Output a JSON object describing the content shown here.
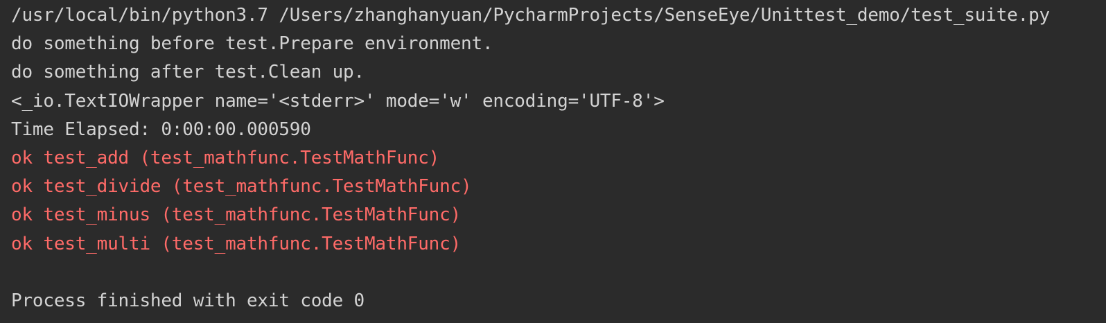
{
  "colors": {
    "background": "#2b2b2b",
    "stdout": "#d3d3d3",
    "stderr": "#ff6b68"
  },
  "console": {
    "command": "/usr/local/bin/python3.7 /Users/zhanghanyuan/PycharmProjects/SenseEye/Unittest_demo/test_suite.py",
    "stdout_lines": [
      "do something before test.Prepare environment.",
      "do something after test.Clean up.",
      "<_io.TextIOWrapper name='<stderr>' mode='w' encoding='UTF-8'>",
      "Time Elapsed: 0:00:00.000590"
    ],
    "stderr_lines": [
      "ok test_add (test_mathfunc.TestMathFunc)",
      "ok test_divide (test_mathfunc.TestMathFunc)",
      "ok test_minus (test_mathfunc.TestMathFunc)",
      "ok test_multi (test_mathfunc.TestMathFunc)"
    ],
    "exit_message": "Process finished with exit code 0"
  }
}
